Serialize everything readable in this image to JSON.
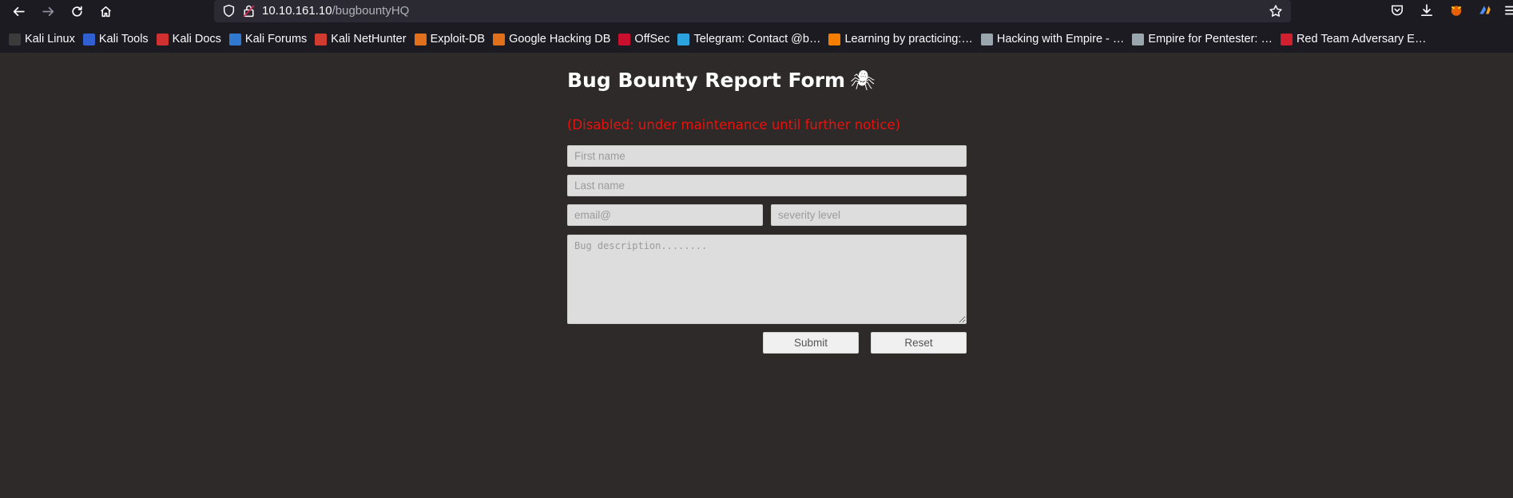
{
  "browser": {
    "url_host": "10.10.161.10",
    "url_path": "/bugbountyHQ",
    "bookmarks": [
      {
        "label": "Kali Linux",
        "color": "#3b3b3b",
        "icon": "kali-dragon-icon"
      },
      {
        "label": "Kali Tools",
        "color": "#2f5fd0",
        "icon": "kali-tools-icon"
      },
      {
        "label": "Kali Docs",
        "color": "#d0302f",
        "icon": "kali-docs-icon"
      },
      {
        "label": "Kali Forums",
        "color": "#2f7ad0",
        "icon": "kali-forums-icon"
      },
      {
        "label": "Kali NetHunter",
        "color": "#d03a2f",
        "icon": "nethunter-icon"
      },
      {
        "label": "Exploit-DB",
        "color": "#e0701c",
        "icon": "exploit-db-icon"
      },
      {
        "label": "Google Hacking DB",
        "color": "#e0701c",
        "icon": "ghdb-icon"
      },
      {
        "label": "OffSec",
        "color": "#c8102e",
        "icon": "offsec-icon"
      },
      {
        "label": "Telegram: Contact @b…",
        "color": "#2aa3de",
        "icon": "telegram-icon"
      },
      {
        "label": "Learning by practicing:…",
        "color": "#f57d00",
        "icon": "blogger-icon"
      },
      {
        "label": "Hacking with Empire - …",
        "color": "#9aa6ad",
        "icon": "wordpress-icon"
      },
      {
        "label": "Empire for Pentester: …",
        "color": "#9aa6ad",
        "icon": "wordpress-icon"
      },
      {
        "label": "Red Team Adversary E…",
        "color": "#d0202f",
        "icon": "shield-icon"
      }
    ]
  },
  "form": {
    "title": "Bug Bounty Report Form",
    "title_icon": "🕷",
    "notice": "(Disabled: under maintenance until further notice)",
    "first_name_placeholder": "First name",
    "last_name_placeholder": "Last name",
    "email_placeholder": "email@",
    "severity_placeholder": "severity level",
    "description_placeholder": "Bug description........",
    "submit_label": "Submit",
    "reset_label": "Reset"
  }
}
